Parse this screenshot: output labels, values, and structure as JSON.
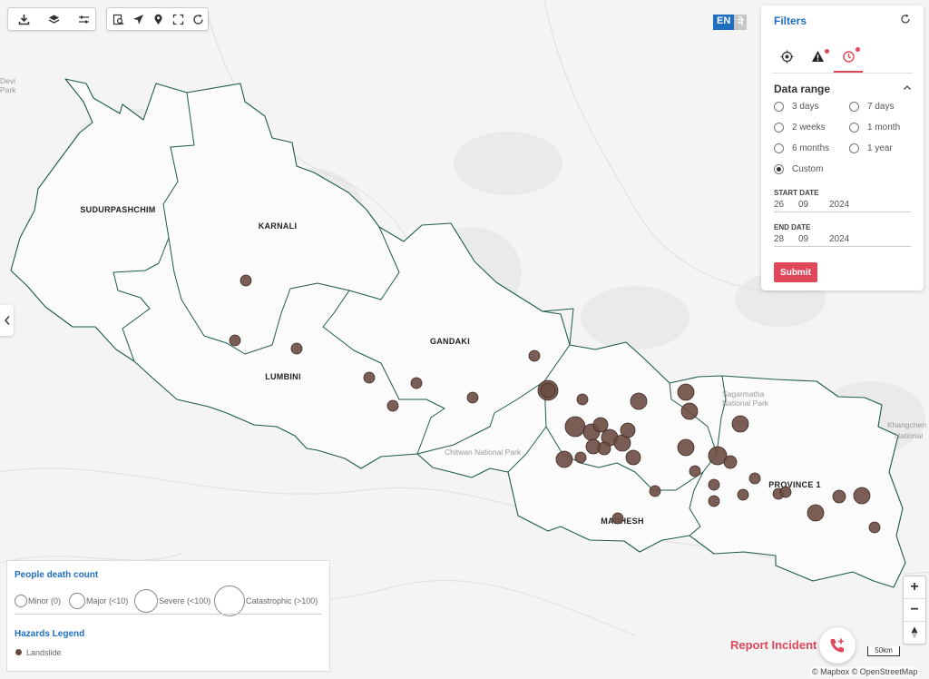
{
  "map": {
    "province_labels": [
      "SUDURPASHCHIM",
      "KARNALI",
      "LUMBINI",
      "GANDAKI",
      "MADHESH",
      "PROVINCE 1"
    ],
    "place_labels": [
      "Sagarmatha",
      "National Park",
      "Chitwan National Park",
      "Khangchen",
      "National",
      "Devi",
      "Park"
    ],
    "landslide_color": "#6b4c42",
    "boundary_color": "#1e5a4a"
  },
  "language": {
    "active": "EN",
    "inactive": "ने"
  },
  "filters": {
    "title": "Filters",
    "section_title": "Data range",
    "options": [
      {
        "label": "3 days",
        "selected": false
      },
      {
        "label": "7 days",
        "selected": false
      },
      {
        "label": "2 weeks",
        "selected": false
      },
      {
        "label": "1 month",
        "selected": false
      },
      {
        "label": "6 months",
        "selected": false
      },
      {
        "label": "1 year",
        "selected": false
      },
      {
        "label": "Custom",
        "selected": true
      }
    ],
    "start_label": "START DATE",
    "start_day": "26",
    "start_month": "09",
    "start_year": "2024",
    "end_label": "END DATE",
    "end_day": "28",
    "end_month": "09",
    "end_year": "2024",
    "submit": "Submit"
  },
  "legend": {
    "death_title": "People death count",
    "sizes": [
      "Minor (0)",
      "Major (<10)",
      "Severe (<100)",
      "Catastrophic (>100)"
    ],
    "hazards_title": "Hazards Legend",
    "hazards": [
      "Landslide"
    ]
  },
  "report": "Report Incident",
  "scale": "50km",
  "attribution": "© Mapbox © OpenStreetMap",
  "zoom": {
    "in": "+",
    "out": "−"
  }
}
